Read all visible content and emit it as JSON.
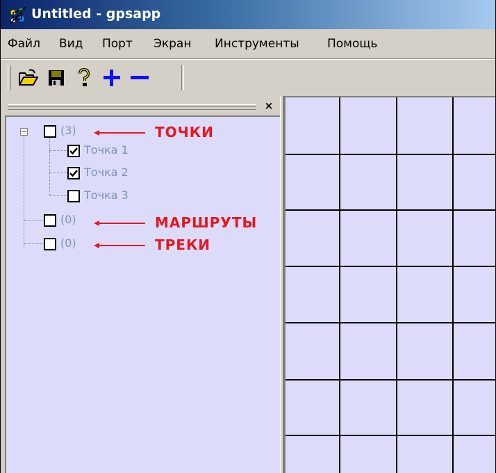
{
  "window": {
    "title": "Untitled - gpsapp",
    "icon": "satellite-app-icon"
  },
  "menu": [
    "Файл",
    "Вид",
    "Порт",
    "Экран",
    "Инструменты",
    "Помощь"
  ],
  "toolbar": {
    "buttons": [
      {
        "name": "open-folder",
        "icon": "folder-open-icon"
      },
      {
        "name": "save",
        "icon": "floppy-disk-icon"
      },
      {
        "name": "help",
        "icon": "question-mark-icon"
      },
      {
        "name": "zoom-in",
        "icon": "plus-icon"
      },
      {
        "name": "zoom-out",
        "icon": "minus-icon"
      }
    ]
  },
  "panel": {
    "close_label": "×"
  },
  "tree": {
    "points": {
      "label": "(3)",
      "checked": false,
      "expanded": true,
      "children": [
        {
          "label": "Точка 1",
          "checked": true
        },
        {
          "label": "Точка 2",
          "checked": true
        },
        {
          "label": "Точка 3",
          "checked": false
        }
      ]
    },
    "routes": {
      "label": "(0)",
      "checked": false
    },
    "tracks": {
      "label": "(0)",
      "checked": false
    }
  },
  "annotations": {
    "points": "ТОЧКИ",
    "routes": "МАРШРУТЫ",
    "tracks": "ТРЕКИ"
  },
  "colors": {
    "annotation": "#e8161f",
    "tree_bg": "#dcdcfa",
    "grid": "#000000",
    "title_blue": "#0a246a"
  }
}
